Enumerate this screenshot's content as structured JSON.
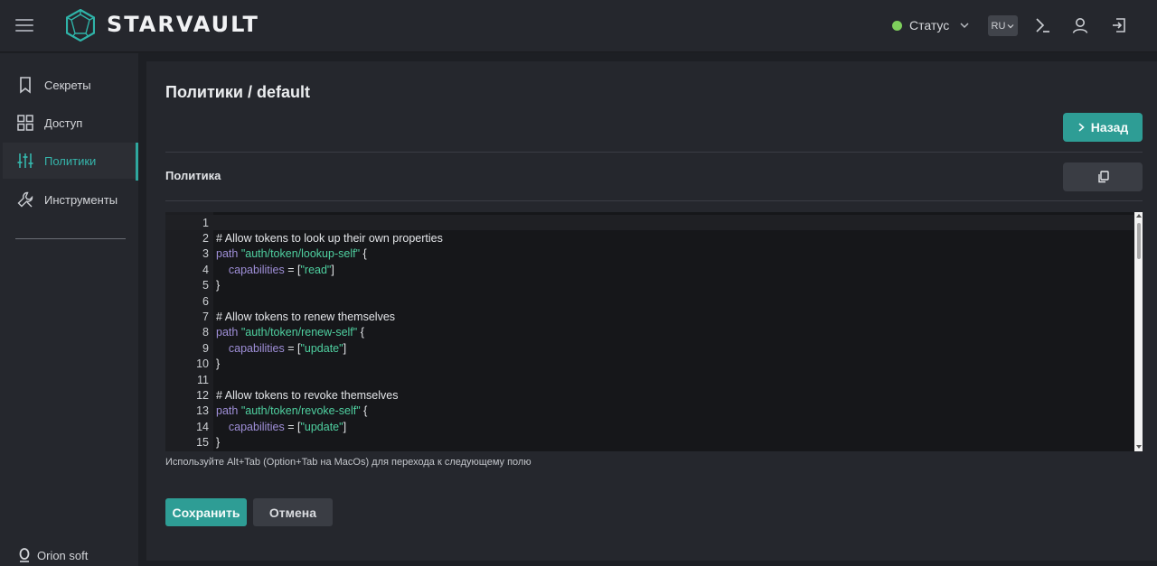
{
  "app": {
    "brand": "STARVAULT"
  },
  "header": {
    "status_label": "Статус",
    "status_color": "#7ecf5c",
    "language": "RU",
    "icons": [
      "terminal-icon",
      "user-icon",
      "logout-icon"
    ]
  },
  "sidebar": {
    "items": [
      {
        "label": "Секреты",
        "icon": "bookmark-icon",
        "active": false
      },
      {
        "label": "Доступ",
        "icon": "grid-icon",
        "active": false
      },
      {
        "label": "Политики",
        "icon": "sliders-icon",
        "active": true
      },
      {
        "label": "Инструменты",
        "icon": "wrench-icon",
        "active": false
      }
    ],
    "footer": "Orion soft"
  },
  "main": {
    "title": "Политики / default",
    "back_label": "Назад",
    "section_label": "Политика",
    "hint": "Используйте Alt+Tab (Option+Tab на MacOs) для перехода к следующему полю",
    "save_label": "Сохранить",
    "cancel_label": "Отмена"
  },
  "editor": {
    "lines": [
      {
        "n": "1",
        "code": ""
      },
      {
        "n": "2",
        "code": "# Allow tokens to look up their own properties"
      },
      {
        "n": "3",
        "code": "path \"auth/token/lookup-self\" {"
      },
      {
        "n": "4",
        "code": "    capabilities = [\"read\"]"
      },
      {
        "n": "5",
        "code": "}"
      },
      {
        "n": "6",
        "code": ""
      },
      {
        "n": "7",
        "code": "# Allow tokens to renew themselves"
      },
      {
        "n": "8",
        "code": "path \"auth/token/renew-self\" {"
      },
      {
        "n": "9",
        "code": "    capabilities = [\"update\"]"
      },
      {
        "n": "10",
        "code": "}"
      },
      {
        "n": "11",
        "code": ""
      },
      {
        "n": "12",
        "code": "# Allow tokens to revoke themselves"
      },
      {
        "n": "13",
        "code": "path \"auth/token/revoke-self\" {"
      },
      {
        "n": "14",
        "code": "    capabilities = [\"update\"]"
      },
      {
        "n": "15",
        "code": "}"
      }
    ]
  },
  "colors": {
    "accent": "#2e9d95",
    "active_text": "#35b5ab",
    "keyword": "#9f8fd8",
    "string": "#4fd0a0"
  }
}
